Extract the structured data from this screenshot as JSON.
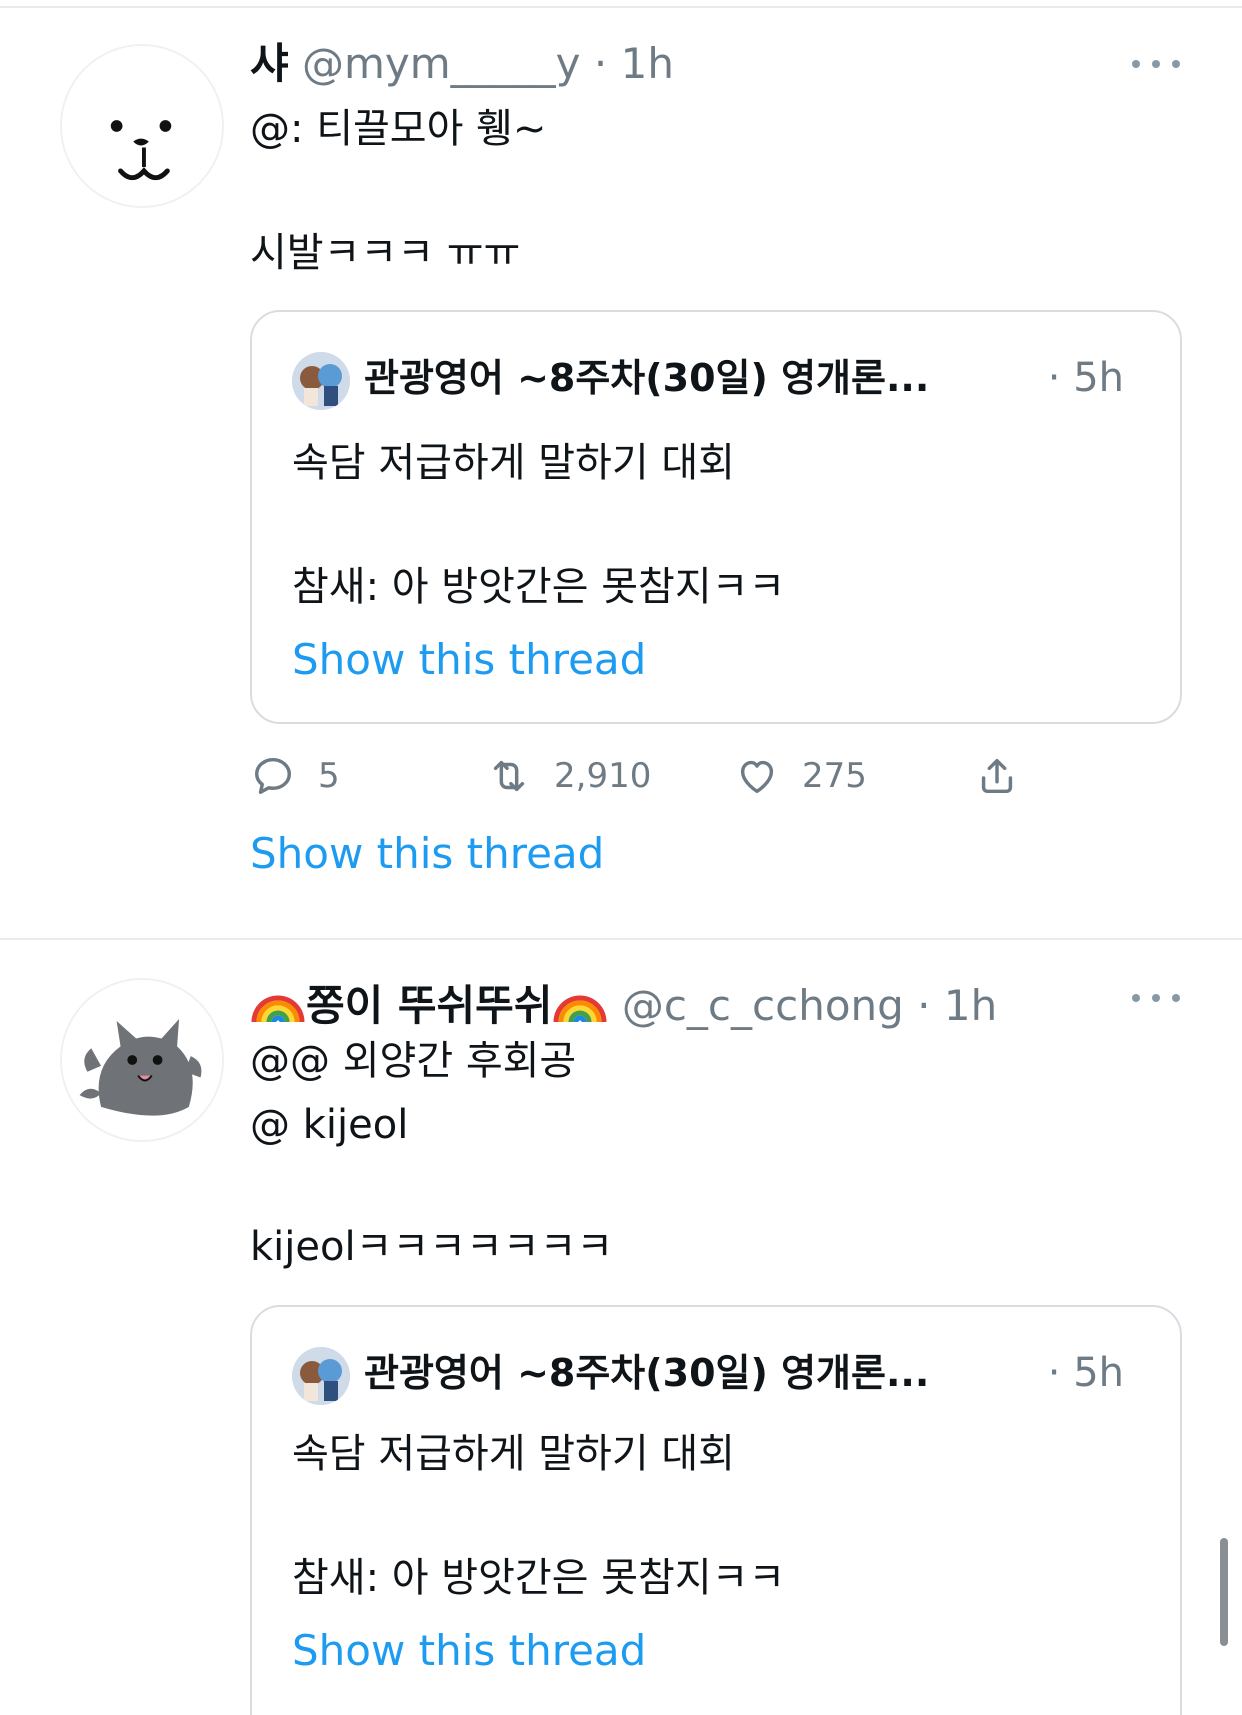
{
  "colors": {
    "link": "#1d9bf0",
    "muted": "#6e7b85",
    "border": "#d8dde2"
  },
  "tweets": [
    {
      "display_name": "샤",
      "handle": "@mym_____y",
      "separator": "·",
      "time": "1h",
      "lines": [
        "@: 티끌모아 휑~",
        "시발ㅋㅋㅋ ㅠㅠ"
      ],
      "quote": {
        "name": "관광영어 ~8주차(30일) 영개론...",
        "time": "· 5h",
        "lines": [
          "속담 저급하게 말하기 대회",
          "참새: 아 방앗간은 못참지ㅋㅋ"
        ],
        "show_thread": "Show this thread"
      },
      "actions": {
        "reply_count": "5",
        "retweet_count": "2,910",
        "like_count": "275"
      },
      "show_thread": "Show this thread"
    },
    {
      "display_name": "쫑이 뚜쉬뚜쉬",
      "handle": "@c_c_cchong",
      "separator": "·",
      "time": "1h",
      "lines": [
        "@@ 외양간 후회공",
        "@ kijeol",
        "kijeolㅋㅋㅋㅋㅋㅋㅋ"
      ],
      "quote": {
        "name": "관광영어 ~8주차(30일) 영개론...",
        "time": "· 5h",
        "lines": [
          "속담 저급하게 말하기 대회",
          "참새: 아 방앗간은 못참지ㅋㅋ"
        ],
        "show_thread": "Show this thread"
      }
    }
  ],
  "icons": {
    "more": "more-horizontal-icon",
    "reply": "reply-icon",
    "retweet": "retweet-icon",
    "like": "heart-icon",
    "share": "share-icon",
    "rainbow": "rainbow-emoji-icon"
  }
}
